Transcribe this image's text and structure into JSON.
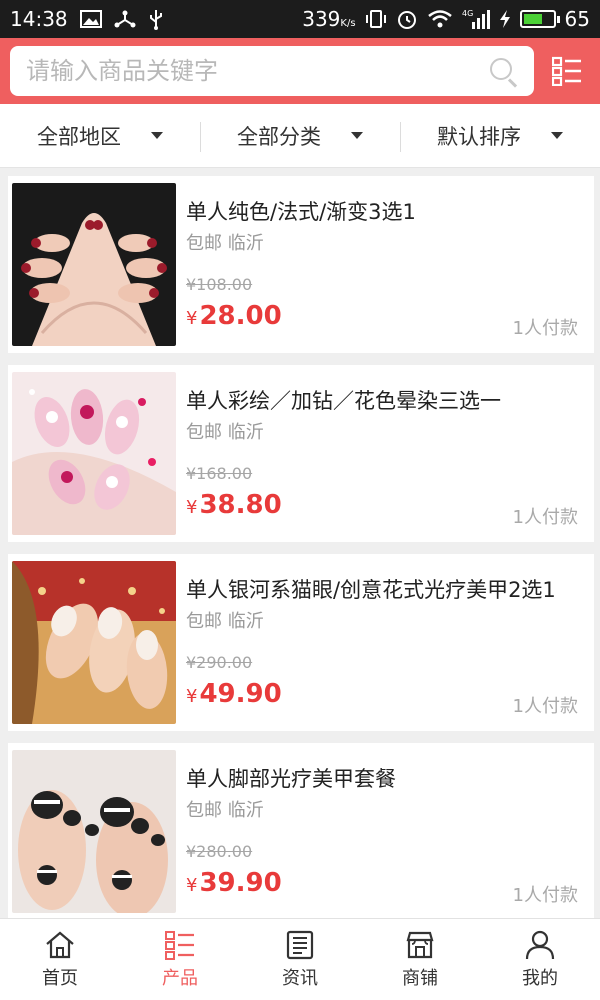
{
  "status_bar": {
    "time": "14:38",
    "speed_value": "339",
    "speed_unit": "K/s",
    "network": "4G",
    "battery": "65",
    "battery_level": 0.65
  },
  "search": {
    "placeholder": "请输入商品关键字",
    "icon": "search-icon"
  },
  "filters": [
    {
      "label": "全部地区"
    },
    {
      "label": "全部分类"
    },
    {
      "label": "默认排序"
    }
  ],
  "products": [
    {
      "title": "单人纯色/法式/渐变3选1",
      "ship": "包邮 临沂",
      "original_price": "¥108.00",
      "currency": "¥",
      "price": "28.00",
      "sales": "1人付款"
    },
    {
      "title": "单人彩绘／加钻／花色晕染三选一",
      "ship": "包邮 临沂",
      "original_price": "¥168.00",
      "currency": "¥",
      "price": "38.80",
      "sales": "1人付款"
    },
    {
      "title": "单人银河系猫眼/创意花式光疗美甲2选1",
      "ship": "包邮 临沂",
      "original_price": "¥290.00",
      "currency": "¥",
      "price": "49.90",
      "sales": "1人付款"
    },
    {
      "title": "单人脚部光疗美甲套餐",
      "ship": "包邮 临沂",
      "original_price": "¥280.00",
      "currency": "¥",
      "price": "39.90",
      "sales": "1人付款"
    }
  ],
  "tabs": [
    {
      "label": "首页",
      "icon": "home-icon",
      "active": false
    },
    {
      "label": "产品",
      "icon": "list-icon",
      "active": true
    },
    {
      "label": "资讯",
      "icon": "news-icon",
      "active": false
    },
    {
      "label": "商铺",
      "icon": "shop-icon",
      "active": false
    },
    {
      "label": "我的",
      "icon": "user-icon",
      "active": false
    }
  ],
  "colors": {
    "accent": "#ef5f5f",
    "price": "#e83a3a",
    "status_bar": "#1c1c1c"
  }
}
